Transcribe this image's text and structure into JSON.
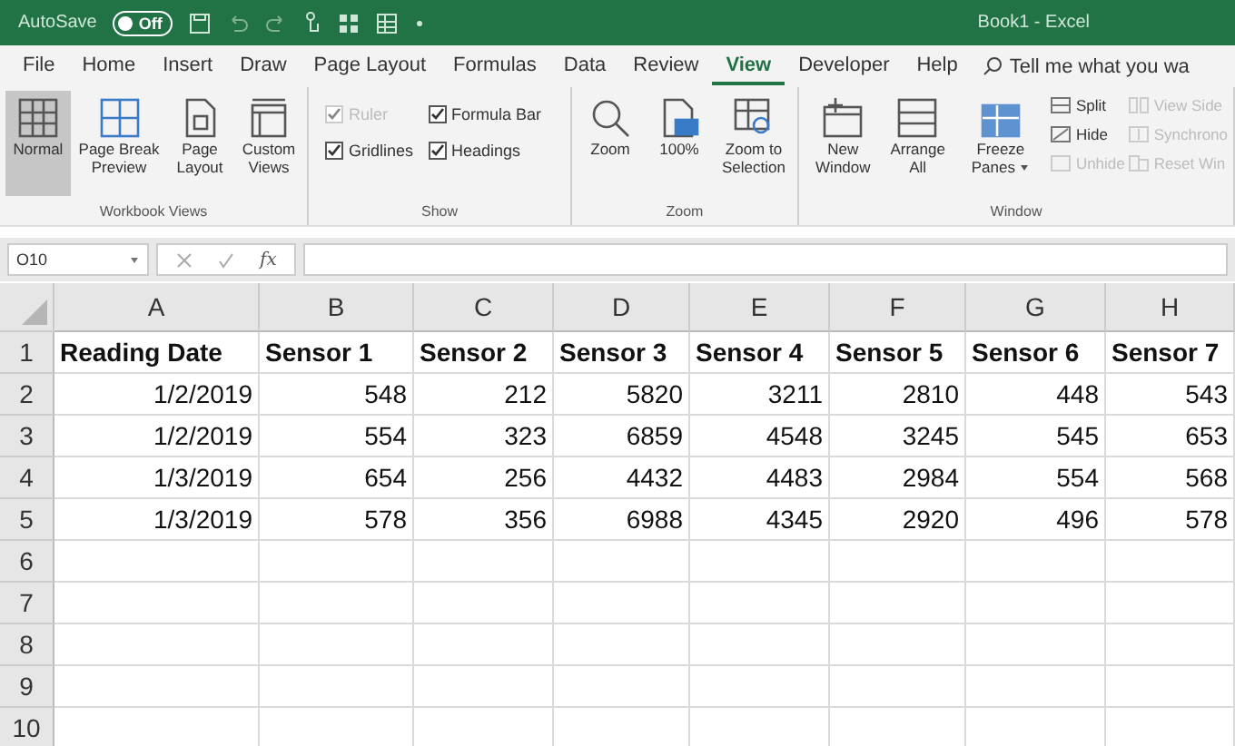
{
  "title_bar": {
    "autosave_label": "AutoSave",
    "autosave_toggle": {
      "label": "Off",
      "on": false
    },
    "title": "Book1 - Excel"
  },
  "menu_tabs": [
    {
      "label": "File",
      "selected": false
    },
    {
      "label": "Home",
      "selected": false
    },
    {
      "label": "Insert",
      "selected": false
    },
    {
      "label": "Draw",
      "selected": false
    },
    {
      "label": "Page Layout",
      "selected": false
    },
    {
      "label": "Formulas",
      "selected": false
    },
    {
      "label": "Data",
      "selected": false
    },
    {
      "label": "Review",
      "selected": false
    },
    {
      "label": "View",
      "selected": true
    },
    {
      "label": "Developer",
      "selected": false
    },
    {
      "label": "Help",
      "selected": false
    }
  ],
  "tell_me": "Tell me what you wa",
  "ribbon_groups": [
    {
      "label": "Workbook Views",
      "buttons": [
        {
          "label": "Normal",
          "selected": true
        },
        {
          "label": "Page Break Preview",
          "selected": false
        },
        {
          "label": "Page Layout",
          "selected": false
        },
        {
          "label": "Custom Views",
          "selected": false
        }
      ]
    },
    {
      "label": "Show",
      "checks": [
        {
          "label": "Ruler",
          "checked": true,
          "disabled": true
        },
        {
          "label": "Formula Bar",
          "checked": true,
          "disabled": false
        },
        {
          "label": "Gridlines",
          "checked": true,
          "disabled": false
        },
        {
          "label": "Headings",
          "checked": true,
          "disabled": false
        }
      ]
    },
    {
      "label": "Zoom",
      "buttons": [
        {
          "label": "Zoom",
          "selected": false
        },
        {
          "label": "100%",
          "selected": false
        },
        {
          "label": "Zoom to Selection",
          "selected": false
        }
      ]
    },
    {
      "label": "Window",
      "buttons": [
        {
          "label": "New Window",
          "selected": false
        },
        {
          "label": "Arrange All",
          "selected": false
        },
        {
          "label": "Freeze Panes",
          "selected": false,
          "dropdown": true
        }
      ],
      "small_columns": [
        [
          {
            "label": "Split",
            "disabled": false
          },
          {
            "label": "Hide",
            "disabled": false
          },
          {
            "label": "Unhide",
            "disabled": true
          }
        ],
        [
          {
            "label": "View Side",
            "disabled": true
          },
          {
            "label": "Synchrono",
            "disabled": true
          },
          {
            "label": "Reset Win",
            "disabled": true
          }
        ]
      ]
    }
  ],
  "formula_bar": {
    "name_box": "O10",
    "function_label": "fx"
  },
  "sheet": {
    "columns": [
      "A",
      "B",
      "C",
      "D",
      "E",
      "F",
      "G",
      "H"
    ],
    "header_row": [
      "Reading Date",
      "Sensor 1",
      "Sensor 2",
      "Sensor 3",
      "Sensor 4",
      "Sensor 5",
      "Sensor 6",
      "Sensor 7"
    ],
    "rows": [
      [
        "1/2/2019",
        "548",
        "212",
        "5820",
        "3211",
        "2810",
        "448",
        "543"
      ],
      [
        "1/2/2019",
        "554",
        "323",
        "6859",
        "4548",
        "3245",
        "545",
        "653"
      ],
      [
        "1/3/2019",
        "654",
        "256",
        "4432",
        "4483",
        "2984",
        "554",
        "568"
      ],
      [
        "1/3/2019",
        "578",
        "356",
        "6988",
        "4345",
        "2920",
        "496",
        "578"
      ]
    ],
    "row_numbers": [
      "1",
      "2",
      "3",
      "4",
      "5",
      "6",
      "7",
      "8",
      "9",
      "10"
    ]
  }
}
